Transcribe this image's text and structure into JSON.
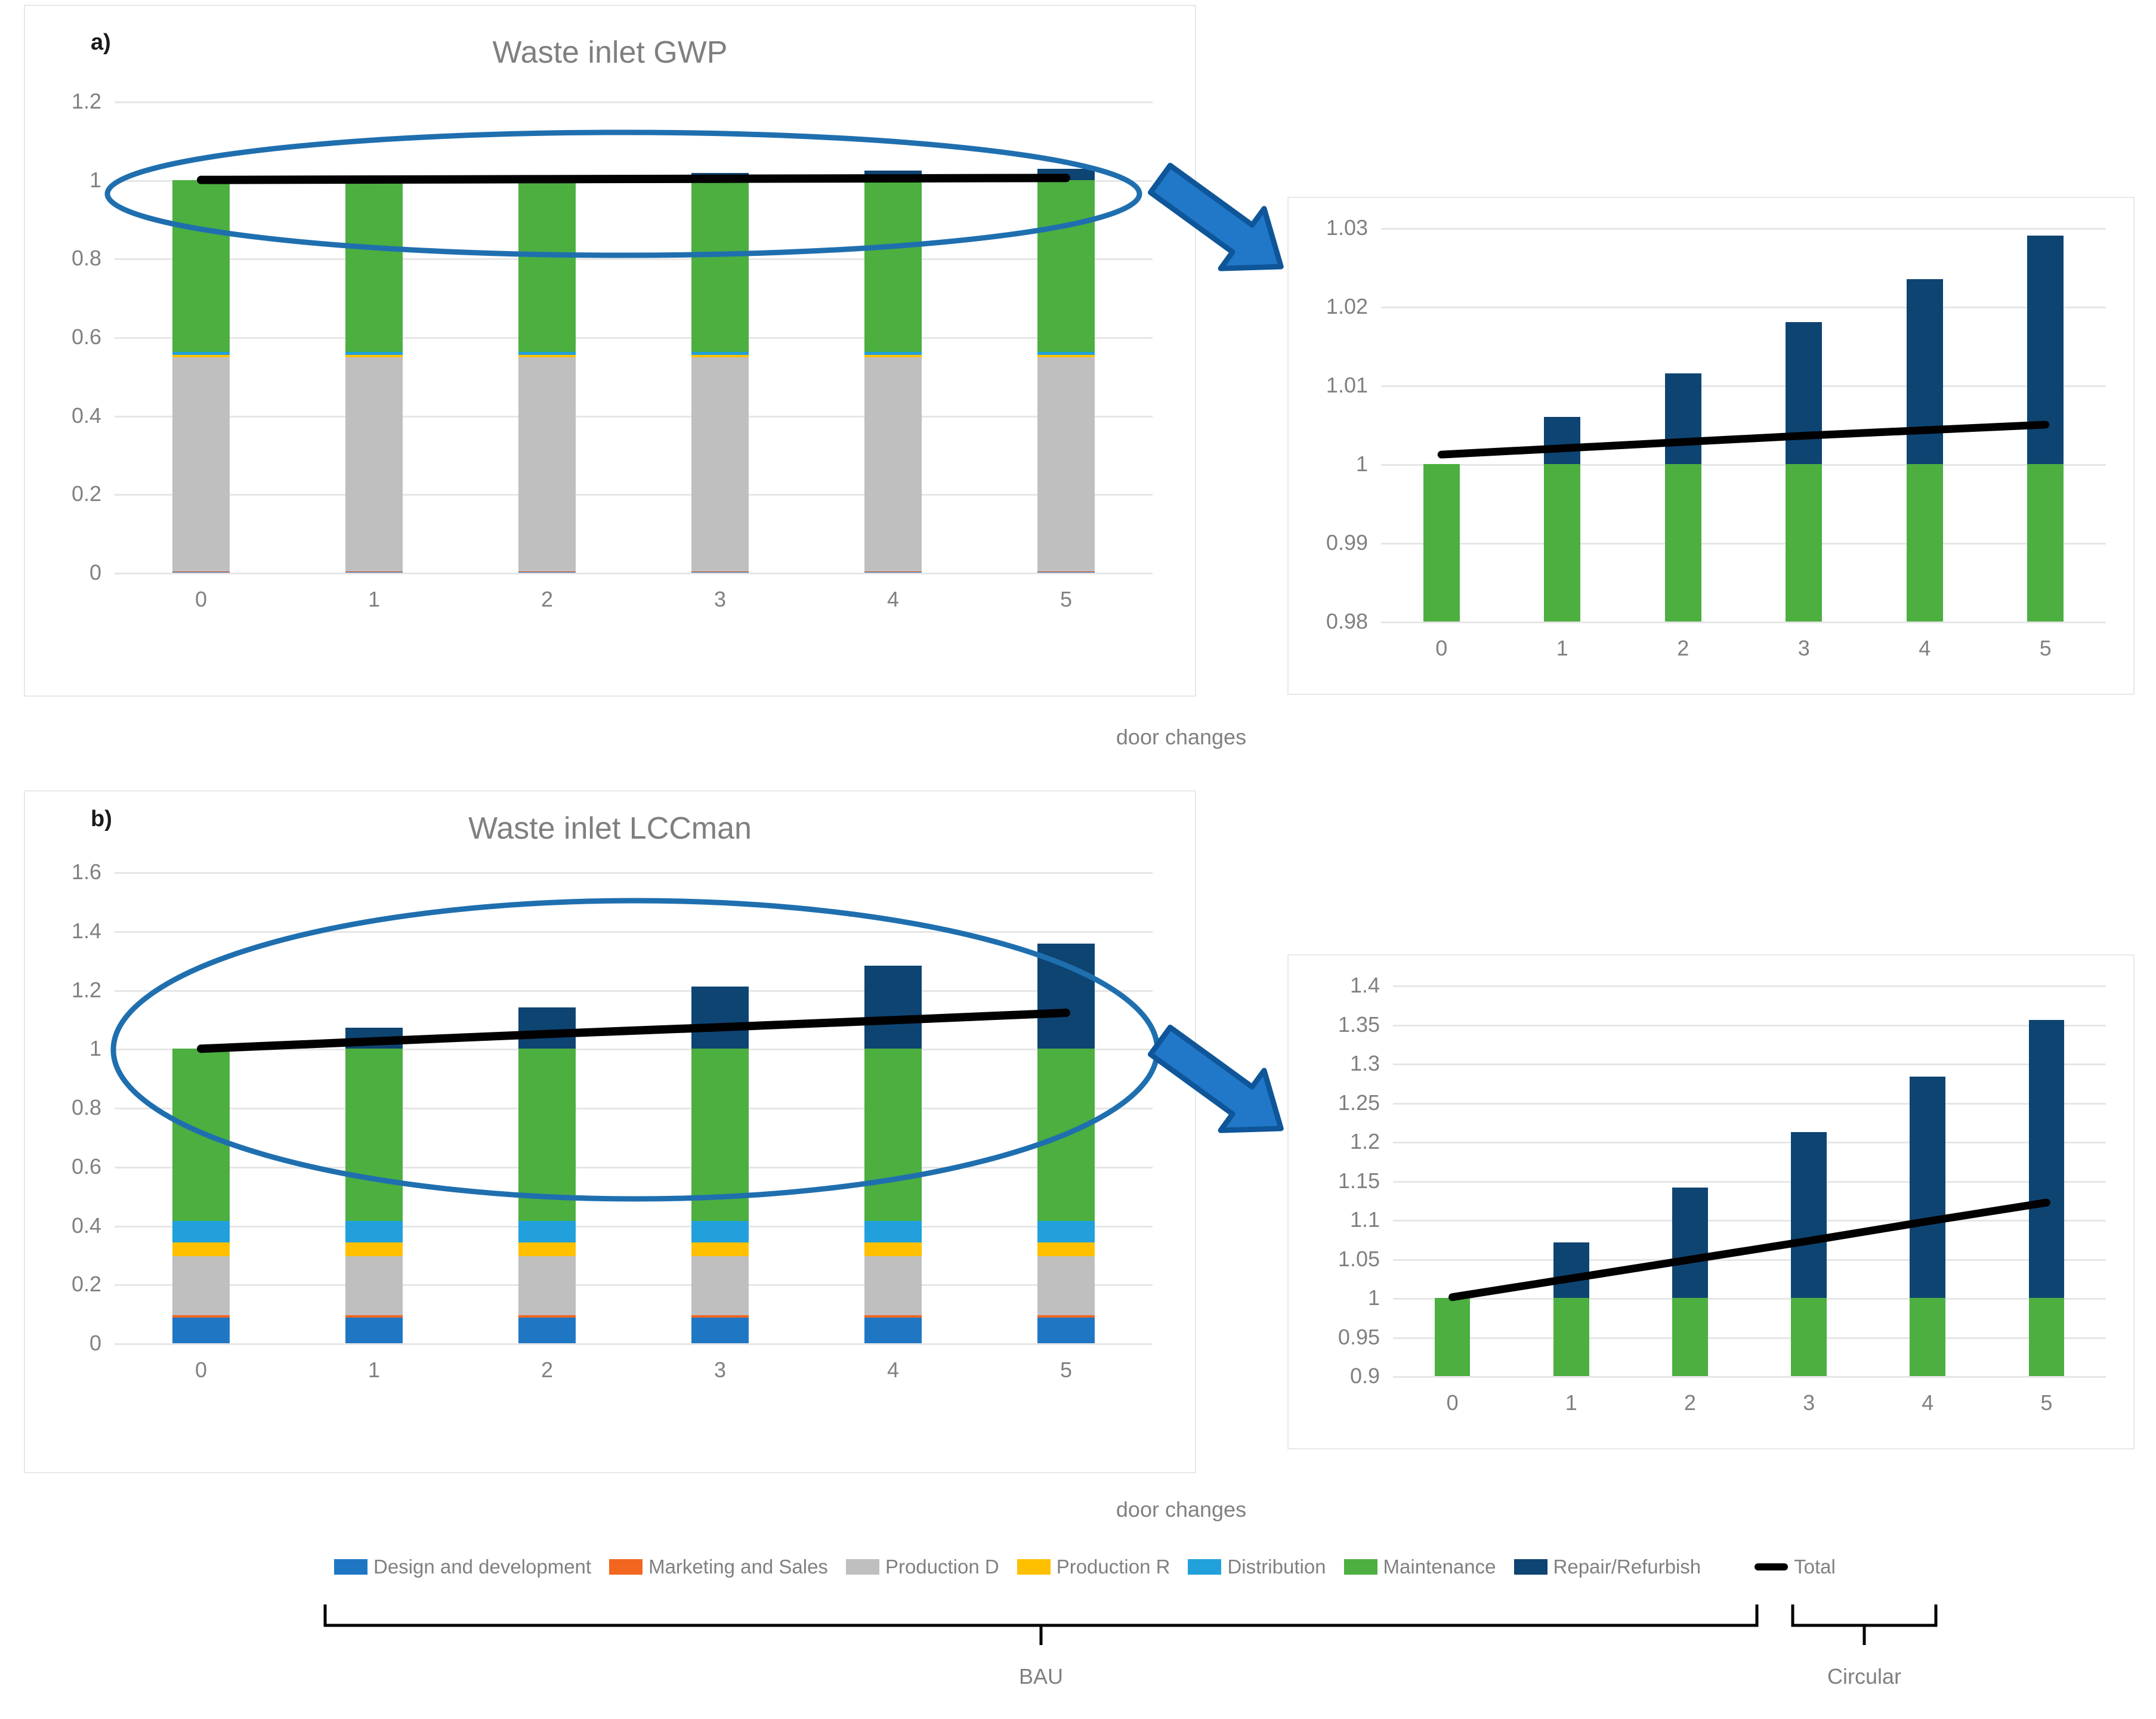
{
  "figure": {
    "panels": [
      {
        "key": "a",
        "label": "a)",
        "title": "Waste inlet GWP"
      },
      {
        "key": "b",
        "label": "b)",
        "title": "Waste inlet LCCman"
      }
    ],
    "axis_title": "door  changes",
    "brackets": [
      {
        "name": "bau",
        "label": "BAU"
      },
      {
        "name": "circular",
        "label": "Circular"
      }
    ]
  },
  "legend": {
    "items": [
      {
        "label": "Design and development",
        "color": "#1F77C4",
        "type": "swatch"
      },
      {
        "label": "Marketing and Sales",
        "color": "#F2661F",
        "type": "swatch"
      },
      {
        "label": "Production D",
        "color": "#BFBFBF",
        "type": "swatch"
      },
      {
        "label": "Production R",
        "color": "#FFC000",
        "type": "swatch"
      },
      {
        "label": "Distribution",
        "color": "#21A0DC",
        "type": "swatch"
      },
      {
        "label": "Maintenance",
        "color": "#4CAF40",
        "type": "swatch"
      },
      {
        "label": "Repair/Refurbish",
        "color": "#0E4472",
        "type": "swatch"
      },
      {
        "label": "Total",
        "color": "#000000",
        "type": "line"
      }
    ]
  },
  "colors": {
    "design": "#1F77C4",
    "marketing": "#F2661F",
    "production_d": "#BFBFBF",
    "production_r": "#FFC000",
    "distribution": "#21A0DC",
    "maintenance": "#4CAF40",
    "repair": "#0E4472",
    "total": "#000000",
    "ellipse": "#1F6FAF",
    "arrow_fill": "#2178C8",
    "arrow_stroke": "#0E5699",
    "gridline": "#E6E6E6",
    "tick_text": "#808080",
    "panel_border": "#E8E8E8"
  },
  "chart_data": [
    {
      "id": "gwp-main",
      "type": "bar",
      "stacked": true,
      "title": "Waste inlet GWP",
      "xlabel": "door  changes",
      "ylabel": "",
      "categories": [
        "0",
        "1",
        "2",
        "3",
        "4",
        "5"
      ],
      "ylim": [
        0,
        1.2
      ],
      "yticks": [
        "0",
        "0.2",
        "0.4",
        "0.6",
        "0.8",
        "1",
        "1.2"
      ],
      "ytick_values": [
        0,
        0.2,
        0.4,
        0.6,
        0.8,
        1,
        1.2
      ],
      "grid": true,
      "legend_position": "bottom",
      "series": [
        {
          "name": "Design and development",
          "color": "#1F77C4",
          "values": [
            0.002,
            0.002,
            0.002,
            0.002,
            0.002,
            0.002
          ]
        },
        {
          "name": "Marketing and Sales",
          "color": "#F2661F",
          "values": [
            0.001,
            0.001,
            0.001,
            0.001,
            0.001,
            0.001
          ]
        },
        {
          "name": "Production D",
          "color": "#BFBFBF",
          "values": [
            0.545,
            0.545,
            0.545,
            0.545,
            0.545,
            0.545
          ]
        },
        {
          "name": "Production R",
          "color": "#FFC000",
          "values": [
            0.006,
            0.006,
            0.006,
            0.006,
            0.006,
            0.006
          ]
        },
        {
          "name": "Distribution",
          "color": "#21A0DC",
          "values": [
            0.008,
            0.008,
            0.008,
            0.008,
            0.008,
            0.008
          ]
        },
        {
          "name": "Maintenance",
          "color": "#4CAF40",
          "values": [
            0.438,
            0.438,
            0.438,
            0.438,
            0.438,
            0.438
          ]
        },
        {
          "name": "Repair/Refurbish",
          "color": "#0E4472",
          "values": [
            0.0,
            0.006,
            0.0115,
            0.018,
            0.0235,
            0.029
          ]
        }
      ],
      "totals": [
        1.0,
        1.006,
        1.0115,
        1.018,
        1.0235,
        1.029
      ],
      "trendline": {
        "name": "Total",
        "color": "#000000",
        "values": [
          1.0,
          1.001,
          1.002,
          1.003,
          1.004,
          1.005
        ]
      }
    },
    {
      "id": "gwp-inset",
      "type": "bar",
      "stacked": true,
      "title": "",
      "categories": [
        "0",
        "1",
        "2",
        "3",
        "4",
        "5"
      ],
      "ylim": [
        0.98,
        1.03
      ],
      "yticks": [
        "0.98",
        "0.99",
        "1",
        "1.01",
        "1.02",
        "1.03"
      ],
      "ytick_values": [
        0.98,
        0.99,
        1.0,
        1.01,
        1.02,
        1.03
      ],
      "grid": true,
      "series": [
        {
          "name": "Maintenance",
          "color": "#4CAF40",
          "values_top": [
            1.0,
            1.0,
            1.0,
            1.0,
            1.0,
            1.0
          ]
        },
        {
          "name": "Repair/Refurbish",
          "color": "#0E4472",
          "values_top": [
            1.0,
            1.006,
            1.0115,
            1.018,
            1.0235,
            1.029
          ]
        }
      ],
      "totals": [
        1.0,
        1.006,
        1.0115,
        1.018,
        1.0235,
        1.029
      ],
      "trendline": {
        "name": "Total",
        "color": "#000000",
        "values": [
          1.0012,
          1.002,
          1.0028,
          1.0036,
          1.0043,
          1.005
        ]
      }
    },
    {
      "id": "lccman-main",
      "type": "bar",
      "stacked": true,
      "title": "Waste inlet LCCman",
      "xlabel": "door  changes",
      "ylabel": "",
      "categories": [
        "0",
        "1",
        "2",
        "3",
        "4",
        "5"
      ],
      "ylim": [
        0,
        1.6
      ],
      "yticks": [
        "0",
        "0.2",
        "0.4",
        "0.6",
        "0.8",
        "1",
        "1.2",
        "1.4",
        "1.6"
      ],
      "ytick_values": [
        0,
        0.2,
        0.4,
        0.6,
        0.8,
        1,
        1.2,
        1.4,
        1.6
      ],
      "grid": true,
      "legend_position": "bottom",
      "series": [
        {
          "name": "Design and development",
          "color": "#1F77C4",
          "values": [
            0.088,
            0.088,
            0.088,
            0.088,
            0.088,
            0.088
          ]
        },
        {
          "name": "Marketing and Sales",
          "color": "#F2661F",
          "values": [
            0.007,
            0.007,
            0.007,
            0.007,
            0.007,
            0.007
          ]
        },
        {
          "name": "Production D",
          "color": "#BFBFBF",
          "values": [
            0.2,
            0.2,
            0.2,
            0.2,
            0.2,
            0.2
          ]
        },
        {
          "name": "Production R",
          "color": "#FFC000",
          "values": [
            0.047,
            0.047,
            0.047,
            0.047,
            0.047,
            0.047
          ]
        },
        {
          "name": "Distribution",
          "color": "#21A0DC",
          "values": [
            0.073,
            0.073,
            0.073,
            0.073,
            0.073,
            0.073
          ]
        },
        {
          "name": "Maintenance",
          "color": "#4CAF40",
          "values": [
            0.585,
            0.585,
            0.585,
            0.585,
            0.585,
            0.585
          ]
        },
        {
          "name": "Repair/Refurbish",
          "color": "#0E4472",
          "values": [
            0.0,
            0.071,
            0.141,
            0.212,
            0.283,
            0.356
          ]
        }
      ],
      "totals": [
        1.0,
        1.071,
        1.141,
        1.212,
        1.283,
        1.356
      ],
      "trendline": {
        "name": "Total",
        "color": "#000000",
        "values": [
          1.0,
          1.025,
          1.05,
          1.073,
          1.097,
          1.122
        ]
      }
    },
    {
      "id": "lccman-inset",
      "type": "bar",
      "stacked": true,
      "title": "",
      "categories": [
        "0",
        "1",
        "2",
        "3",
        "4",
        "5"
      ],
      "ylim": [
        0.9,
        1.4
      ],
      "yticks": [
        "0.9",
        "0.95",
        "1",
        "1.05",
        "1.1",
        "1.15",
        "1.2",
        "1.25",
        "1.3",
        "1.35",
        "1.4"
      ],
      "ytick_values": [
        0.9,
        0.95,
        1.0,
        1.05,
        1.1,
        1.15,
        1.2,
        1.25,
        1.3,
        1.35,
        1.4
      ],
      "grid": true,
      "series": [
        {
          "name": "Maintenance",
          "color": "#4CAF40",
          "values_top": [
            1.0,
            1.0,
            1.0,
            1.0,
            1.0,
            1.0
          ]
        },
        {
          "name": "Repair/Refurbish",
          "color": "#0E4472",
          "values_top": [
            1.0,
            1.071,
            1.141,
            1.212,
            1.283,
            1.356
          ]
        }
      ],
      "totals": [
        1.0,
        1.071,
        1.141,
        1.212,
        1.283,
        1.356
      ],
      "trendline": {
        "name": "Total",
        "color": "#000000",
        "values": [
          1.001,
          1.025,
          1.049,
          1.073,
          1.098,
          1.122
        ]
      }
    }
  ]
}
